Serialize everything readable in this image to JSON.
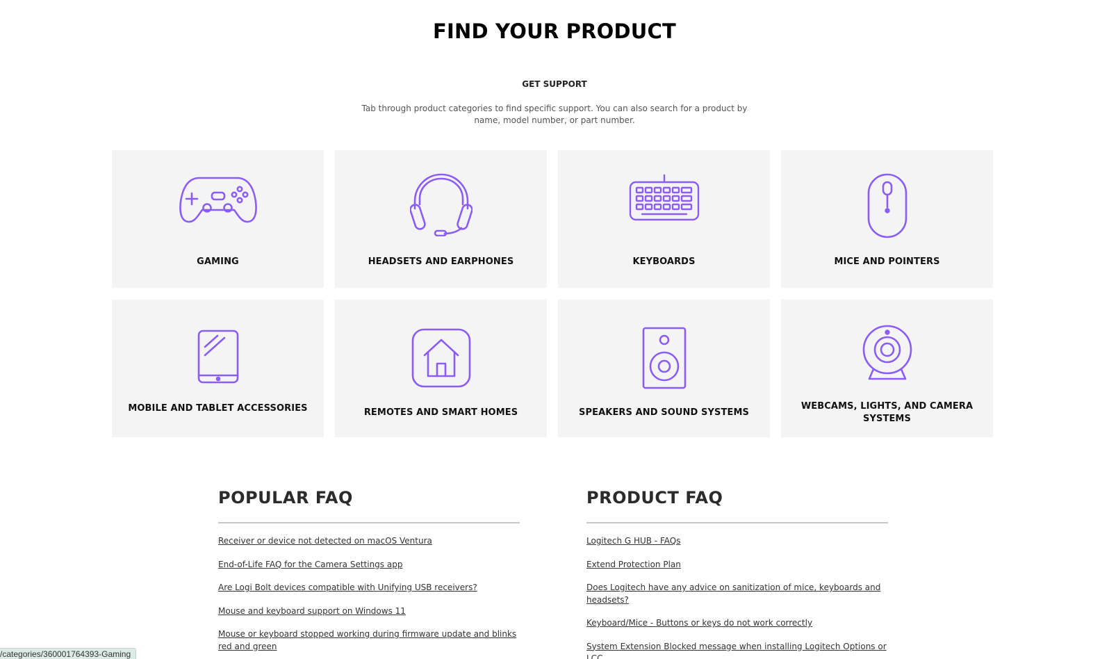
{
  "header": {
    "title": "FIND YOUR PRODUCT",
    "kicker": "GET SUPPORT",
    "intro": "Tab through product categories to find specific support. You can also search for a product by name, model number, or part number."
  },
  "theme": {
    "accent": "#8b5cf6",
    "card_bg": "#f4f4f4"
  },
  "categories": [
    {
      "label": "GAMING",
      "icon": "gamepad-icon"
    },
    {
      "label": "HEADSETS AND EARPHONES",
      "icon": "headset-icon"
    },
    {
      "label": "KEYBOARDS",
      "icon": "keyboard-icon"
    },
    {
      "label": "MICE AND POINTERS",
      "icon": "mouse-icon"
    },
    {
      "label": "MOBILE AND TABLET ACCESSORIES",
      "icon": "tablet-icon"
    },
    {
      "label": "REMOTES AND SMART HOMES",
      "icon": "home-icon"
    },
    {
      "label": "SPEAKERS AND SOUND SYSTEMS",
      "icon": "speaker-icon"
    },
    {
      "label": "WEBCAMS, LIGHTS, AND CAMERA SYSTEMS",
      "icon": "webcam-icon"
    }
  ],
  "popular_faq": {
    "title": "POPULAR FAQ",
    "items": [
      "Receiver or device not detected on macOS Ventura",
      "End-of-Life FAQ for the Camera Settings app",
      "Are Logi Bolt devices compatible with Unifying USB receivers?",
      "Mouse and keyboard support on Windows 11",
      "Mouse or keyboard stopped working during firmware update and blinks red and green"
    ]
  },
  "product_faq": {
    "title": "PRODUCT FAQ",
    "items": [
      "Logitech G HUB - FAQs",
      "Extend Protection Plan",
      "Does Logitech have any advice on sanitization of mice, keyboards and headsets?",
      "Keyboard/Mice - Buttons or keys do not work correctly",
      "System Extension Blocked message when installing Logitech Options or LCC"
    ]
  },
  "status_bar": {
    "url": "/categories/360001764393-Gaming"
  }
}
